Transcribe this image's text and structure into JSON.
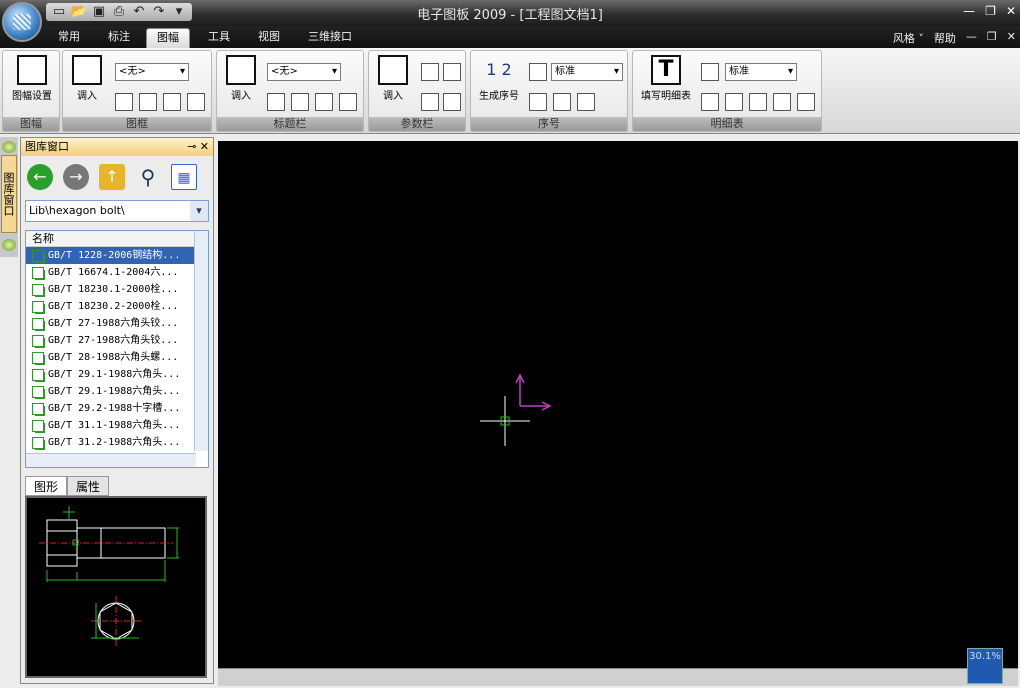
{
  "window": {
    "title": "电子图板 2009 - [工程图文档1]"
  },
  "tabs": [
    "常用",
    "标注",
    "图幅",
    "工具",
    "视图",
    "三维接口"
  ],
  "right_menu": {
    "style_label": "风格",
    "help_label": "帮助"
  },
  "ribbon": {
    "groups": [
      {
        "label": "图幅",
        "buttons": [
          "图幅设置"
        ]
      },
      {
        "label": "图框",
        "buttons": [
          "调入"
        ],
        "dropdown": "<无>"
      },
      {
        "label": "标题栏",
        "buttons": [
          "调入"
        ],
        "dropdown": "<无>"
      },
      {
        "label": "参数栏",
        "buttons": [
          "调入"
        ]
      },
      {
        "label": "序号",
        "buttons": [
          "生成序号"
        ],
        "dropdown": "标准"
      },
      {
        "label": "明细表",
        "buttons": [
          "填写明细表"
        ],
        "dropdown": "标准"
      }
    ]
  },
  "side_strip": {
    "label": "图库窗口"
  },
  "panel": {
    "title": "图库窗口",
    "path": "Lib\\hexagon bolt\\",
    "column_header": "名称",
    "items": [
      "GB/T 1228-2006钢结构...",
      "GB/T 16674.1-2004六...",
      "GB/T 18230.1-2000栓...",
      "GB/T 18230.2-2000栓...",
      "GB/T 27-1988六角头铰...",
      "GB/T 27-1988六角头铰...",
      "GB/T 28-1988六角头螺...",
      "GB/T 29.1-1988六角头...",
      "GB/T 29.1-1988六角头...",
      "GB/T 29.2-1988十字槽...",
      "GB/T 31.1-1988六角头...",
      "GB/T 31.2-1988六角头..."
    ],
    "tabs": [
      "图形",
      "属性"
    ]
  },
  "status": {
    "zoom": "30.1%"
  },
  "colors": {
    "canvas": "#000000",
    "axis": "#c040c0",
    "cursor": "#ffffff",
    "selection": "#3264b4"
  }
}
